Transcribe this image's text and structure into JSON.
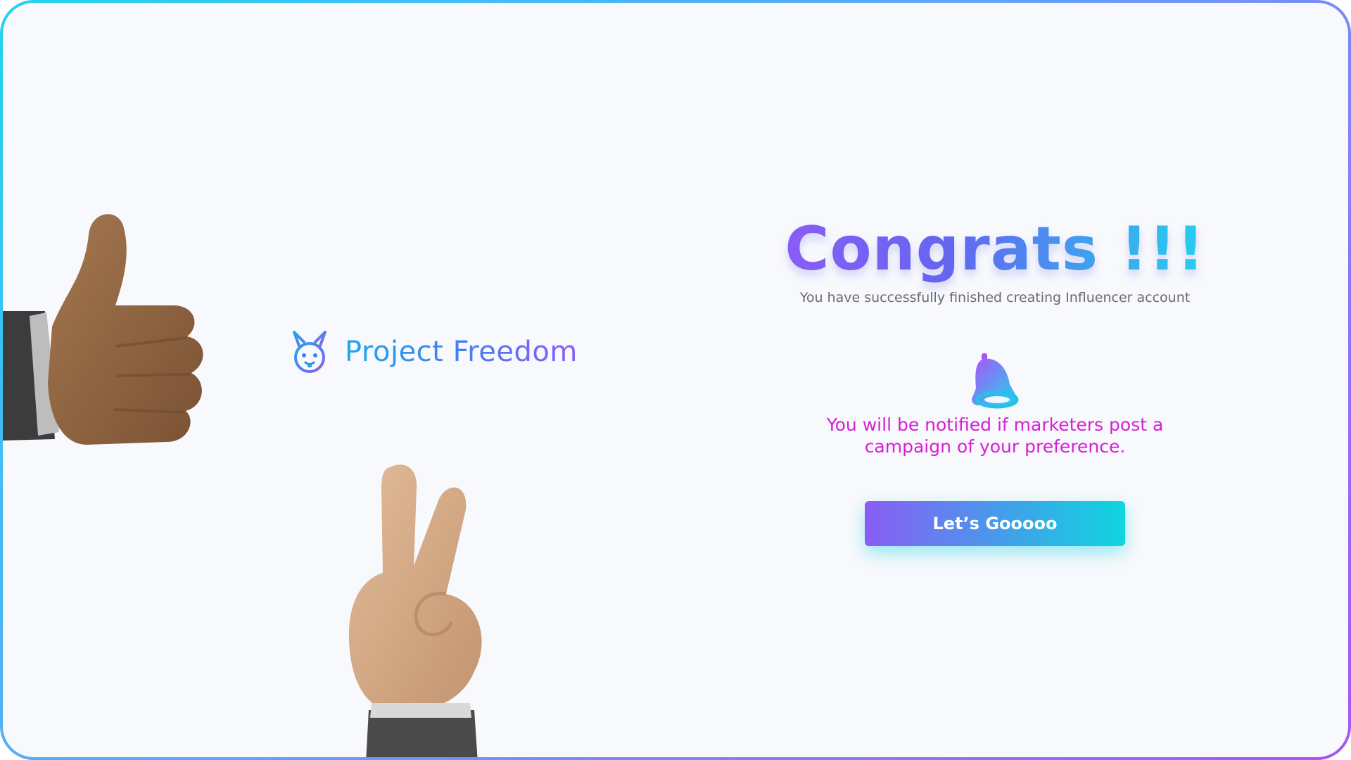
{
  "brand": {
    "name": "Project Freedom",
    "logo_icon": "bunny-icon"
  },
  "main": {
    "title": "Congrats !!!",
    "subtitle": "You have successfully finished creating Influencer account",
    "notice_icon": "bell-icon",
    "notice_line1": "You will be notified if marketers post a",
    "notice_line2": "campaign of your preference.",
    "cta_label": "Let’s Gooooo"
  },
  "decor": {
    "left_hand": "thumbs-up-hand-icon",
    "bottom_hand": "peace-sign-hand-icon"
  },
  "colors": {
    "accent_purple": "#8b5cf6",
    "accent_cyan": "#22d3ee",
    "notice_magenta": "#d61fd6",
    "subtitle_gray": "#6b6b6b",
    "background": "#f8f9fc"
  }
}
